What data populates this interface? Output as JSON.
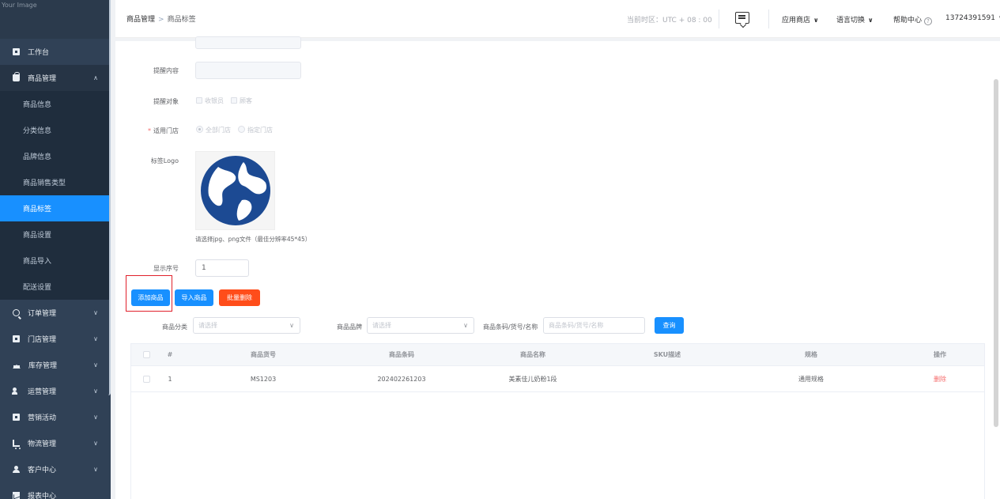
{
  "logo": {
    "alt_text": "Your Image"
  },
  "sidebar": {
    "items": [
      {
        "label": "工作台"
      },
      {
        "label": "商品管理",
        "expanded": true
      },
      {
        "label": "订单管理"
      },
      {
        "label": "门店管理"
      },
      {
        "label": "库存管理"
      },
      {
        "label": "运营管理"
      },
      {
        "label": "营销活动"
      },
      {
        "label": "物流管理"
      },
      {
        "label": "客户中心"
      },
      {
        "label": "报表中心"
      }
    ],
    "sub_items": [
      {
        "label": "商品信息"
      },
      {
        "label": "分类信息"
      },
      {
        "label": "品牌信息"
      },
      {
        "label": "商品销售类型"
      },
      {
        "label": "商品标签",
        "active": true
      },
      {
        "label": "商品设置"
      },
      {
        "label": "商品导入"
      },
      {
        "label": "配送设置"
      }
    ]
  },
  "header": {
    "breadcrumb": {
      "parent": "商品管理",
      "separator": ">",
      "current": "商品标签"
    },
    "timezone": "当前时区：UTC + 08 : 00",
    "app_store": "应用商店",
    "language": "语言切换",
    "help": "帮助中心",
    "help_icon": "?",
    "account": "13724391591",
    "caret": "∨"
  },
  "form": {
    "reminder_content_label": "提醒内容",
    "reminder_target_label": "提醒对象",
    "target_options": [
      "收银员",
      "顾客"
    ],
    "store_label": "适用门店",
    "required_mark": "*",
    "store_options": [
      "全部门店",
      "指定门店"
    ],
    "store_selected": "全部门店",
    "logo_label": "标签Logo",
    "logo_hint": "请选择jpg、png文件（最佳分辨率45*45）",
    "order_label": "显示序号",
    "order_value": "1"
  },
  "actions": {
    "add_product": "添加商品",
    "import_product": "导入商品",
    "batch_delete": "批量删除"
  },
  "filters": {
    "category_label": "商品分类",
    "category_placeholder": "请选择",
    "brand_label": "商品品牌",
    "brand_placeholder": "请选择",
    "code_label": "商品条码/货号/名称",
    "code_placeholder": "商品条码/货号/名称",
    "query": "查询",
    "select_arrow": "∨"
  },
  "table": {
    "headers": [
      "#",
      "商品货号",
      "商品条码",
      "商品名称",
      "SKU描述",
      "规格",
      "操作"
    ],
    "rows": [
      {
        "index": "1",
        "item_no": "MS1203",
        "barcode": "202402261203",
        "name": "美素佳儿奶粉1段",
        "sku": "",
        "spec": "通用规格",
        "action": "删除"
      }
    ]
  },
  "colors": {
    "sidebar_bg": "#304156",
    "active_blue": "#1890ff",
    "danger_red": "#ff4d1a",
    "highlight": "#e0212b"
  }
}
